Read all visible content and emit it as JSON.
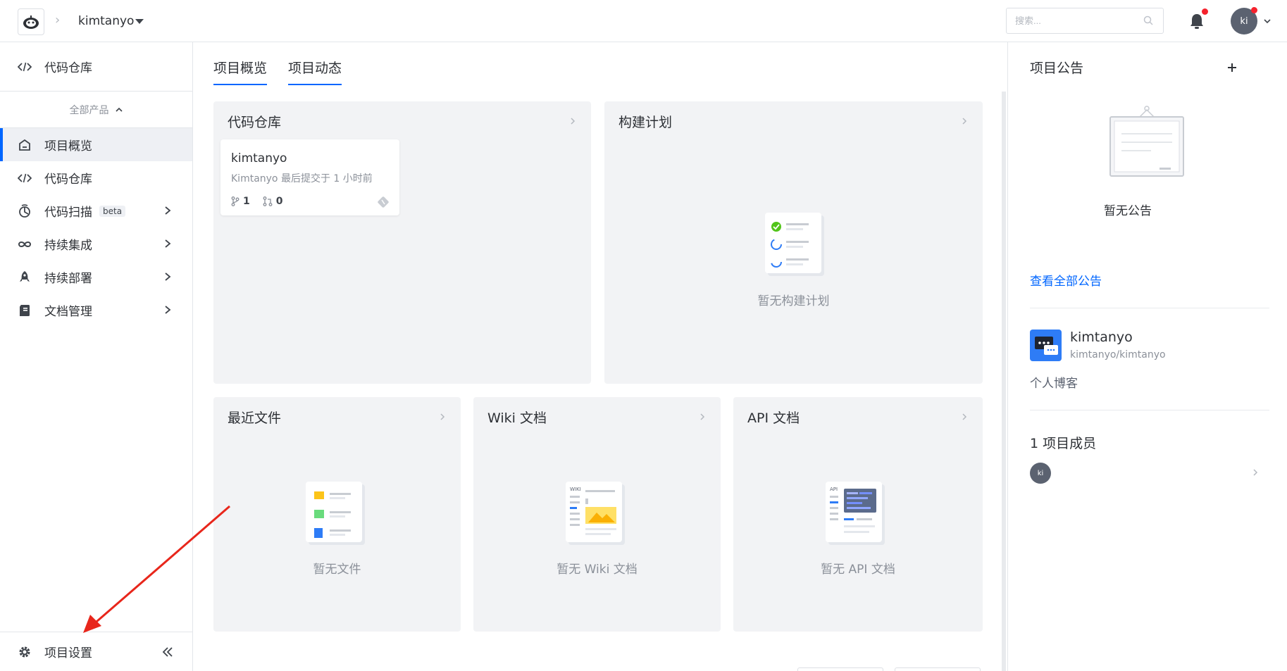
{
  "header": {
    "project_name": "kimtanyo",
    "search_placeholder": "搜索...",
    "avatar_initials": "ki"
  },
  "sidebar": {
    "repo_top": "代码仓库",
    "all_products": "全部产品",
    "items": [
      {
        "label": "项目概览",
        "icon": "home-icon",
        "active": true,
        "has_arrow": false
      },
      {
        "label": "代码仓库",
        "icon": "code-icon",
        "active": false,
        "has_arrow": false
      },
      {
        "label": "代码扫描",
        "icon": "scan-icon",
        "active": false,
        "has_arrow": true,
        "badge": "beta"
      },
      {
        "label": "持续集成",
        "icon": "infinity-icon",
        "active": false,
        "has_arrow": true
      },
      {
        "label": "持续部署",
        "icon": "rocket-icon",
        "active": false,
        "has_arrow": true
      },
      {
        "label": "文档管理",
        "icon": "document-icon",
        "active": false,
        "has_arrow": true
      }
    ],
    "settings_label": "项目设置"
  },
  "main": {
    "tabs": [
      {
        "label": "项目概览"
      },
      {
        "label": "项目动态"
      }
    ],
    "cards": {
      "repo": {
        "title": "代码仓库",
        "repo_name": "kimtanyo",
        "repo_sub": "Kimtanyo 最后提交于 1 小时前",
        "branches": "1",
        "merge_requests": "0"
      },
      "build": {
        "title": "构建计划",
        "empty": "暂无构建计划"
      },
      "files": {
        "title": "最近文件",
        "empty": "暂无文件"
      },
      "wiki": {
        "title": "Wiki 文档",
        "empty": "暂无 Wiki 文档"
      },
      "api": {
        "title": "API 文档",
        "empty": "暂无 API 文档"
      }
    }
  },
  "right": {
    "announce_title": "项目公告",
    "announce_empty": "暂无公告",
    "view_all": "查看全部公告",
    "project_name": "kimtanyo",
    "project_path": "kimtanyo/kimtanyo",
    "project_desc": "个人博客",
    "members_title": "1 项目成员",
    "member_initials": "ki"
  },
  "colors": {
    "accent": "#0066ff",
    "notification_dot": "#f5222d",
    "annotation_arrow": "#e8261b"
  }
}
